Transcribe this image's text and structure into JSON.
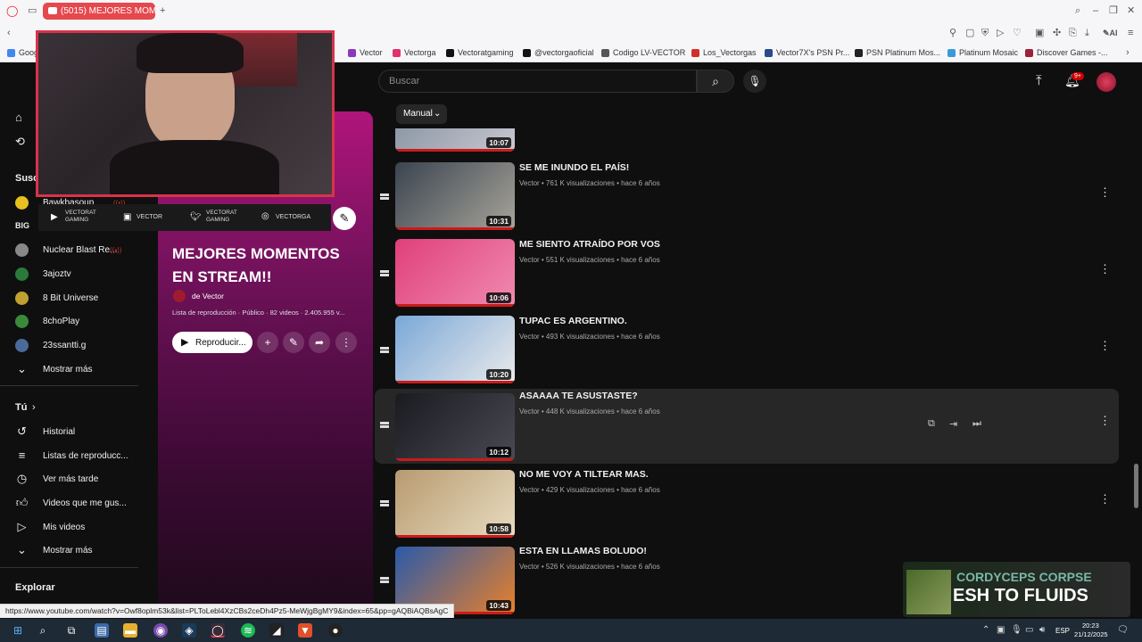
{
  "browser": {
    "tab_title": "(5015) MEJORES MOMEN",
    "status_url": "https://www.youtube.com/watch?v=Owf8oplm53k&list=PLToLebl4XzCBs2ceDh4Pz5-MeWjgBgMY9&index=65&pp=gAQBiAQBsAgC",
    "bookmarks": [
      "Goog",
      "Vector",
      "Vectorga",
      "Vectoratgaming",
      "@vectorgaoficial",
      "Codigo LV-VECTOR",
      "Los_Vectorgas",
      "Vector7X's PSN Pr...",
      "PSN Platinum Mos...",
      "Platinum Mosaic",
      "Discover Games -..."
    ]
  },
  "search": {
    "placeholder": "Buscar"
  },
  "header": {
    "notif_badge": "9+"
  },
  "sort": {
    "label": "Manual"
  },
  "sidebar": {
    "subs_heading": "Susc",
    "subscriptions": [
      {
        "name": "Bawkbasoup",
        "color": "#e8c020"
      },
      {
        "name": "Nuclear Blast Re...",
        "color": "#888888"
      },
      {
        "name": "3ajoztv",
        "color": "#2a7a3a"
      },
      {
        "name": "8 Bit Universe",
        "color": "#c0a030"
      },
      {
        "name": "8choPlay",
        "color": "#3a8a3a"
      },
      {
        "name": "23ssantti.g",
        "color": "#4a6a9a"
      }
    ],
    "show_more_1": "Mostrar más",
    "you_heading": "Tú",
    "you_items": [
      {
        "label": "Historial",
        "icon": "history-icon"
      },
      {
        "label": "Listas de reproducc...",
        "icon": "playlists-icon"
      },
      {
        "label": "Ver más tarde",
        "icon": "watch-later-icon"
      },
      {
        "label": "Videos que me gus...",
        "icon": "like-icon"
      },
      {
        "label": "Mis videos",
        "icon": "my-videos-icon"
      }
    ],
    "show_more_2": "Mostrar más",
    "explore_heading": "Explorar"
  },
  "overlay": {
    "socials": [
      "VECTORAT GAMING",
      "VECTOR",
      "VECTORAT GAMING",
      "VECTORGA"
    ]
  },
  "playlist": {
    "title": "MEJORES MOMENTOS EN STREAM!!",
    "owner": "de Vector",
    "meta": "Lista de reproducción · Público · 82 videos · 2.405.955 v...",
    "play_label": "Reproducir..."
  },
  "videos": [
    {
      "title": "",
      "meta": "",
      "duration": "10:07",
      "c1": "#7a8a9a",
      "c2": "#c8c8d0",
      "partial": true
    },
    {
      "title": "SE ME INUNDO EL PAÍS!",
      "meta": "Vector • 761 K visualizaciones • hace 6 años",
      "duration": "10:31",
      "c1": "#3a4450",
      "c2": "#a8a49a"
    },
    {
      "title": "ME SIENTO ATRAÍDO POR VOS",
      "meta": "Vector • 551 K visualizaciones • hace 6 años",
      "duration": "10:06",
      "c1": "#e0407a",
      "c2": "#f08ab0"
    },
    {
      "title": "TUPAC ES ARGENTINO.",
      "meta": "Vector • 493 K visualizaciones • hace 6 años",
      "duration": "10:20",
      "c1": "#7aa8d8",
      "c2": "#eaeaea"
    },
    {
      "title": "ASAAAA TE ASUSTASTE?",
      "meta": "Vector • 448 K visualizaciones • hace 6 años",
      "duration": "10:12",
      "c1": "#1a1a20",
      "c2": "#4a4a55"
    },
    {
      "title": "NO ME VOY A TILTEAR MAS.",
      "meta": "Vector • 429 K visualizaciones • hace 6 años",
      "duration": "10:58",
      "c1": "#b89a70",
      "c2": "#e8dcc0"
    },
    {
      "title": "ESTA EN LLAMAS BOLUDO!",
      "meta": "Vector • 526 K visualizaciones • hace 6 años",
      "duration": "10:43",
      "c1": "#2a5aaa",
      "c2": "#e8802a"
    }
  ],
  "stream_overlay": {
    "line1": "CORDYCEPS CORPSE",
    "line2": "ESH TO FLUIDS"
  },
  "taskbar": {
    "lang": "ESP",
    "time": "20:23",
    "date": "21/12/2025"
  }
}
